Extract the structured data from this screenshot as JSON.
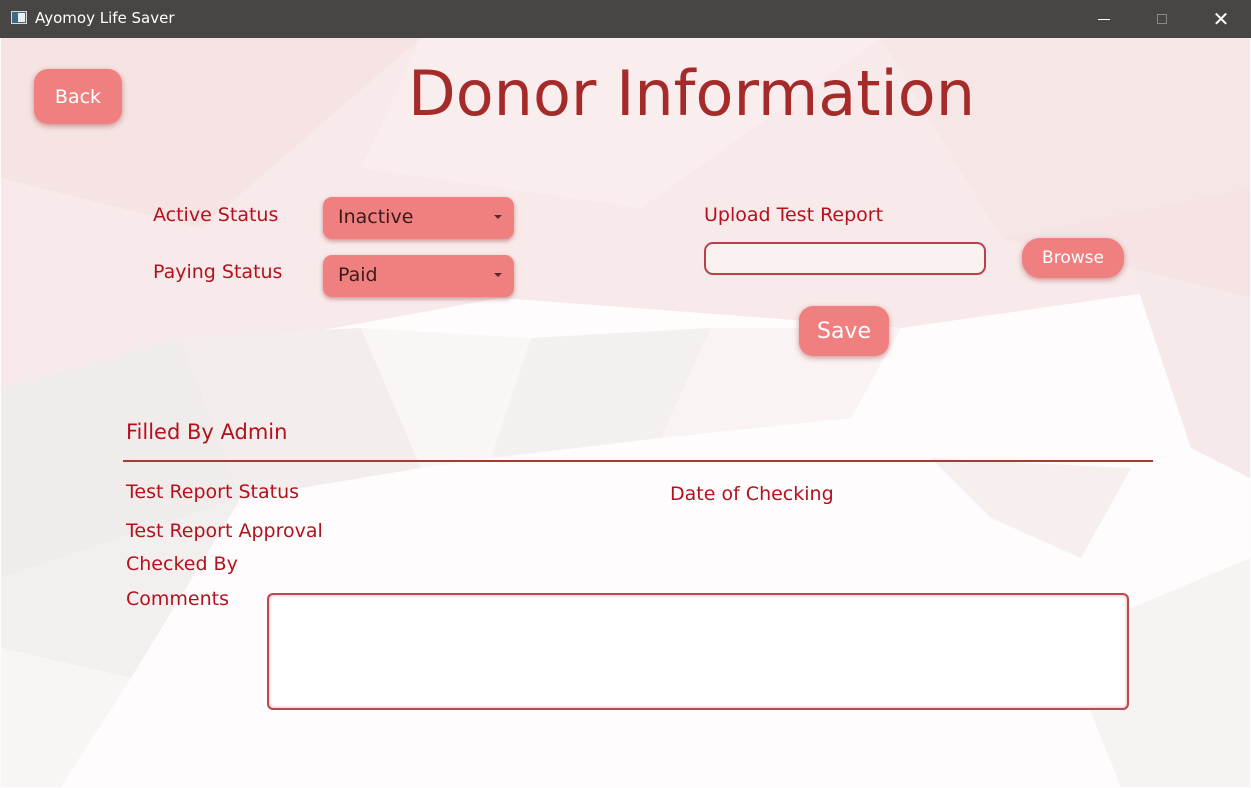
{
  "window": {
    "title": "Ayomoy Life Saver",
    "icon": "app-window-icon",
    "controls": {
      "minimize_icon": "minimize-icon",
      "maximize_icon": "maximize-icon",
      "close_icon": "close-icon",
      "close_glyph": "✕"
    }
  },
  "header": {
    "back_label": "Back",
    "title": "Donor Information"
  },
  "status": {
    "active_label": "Active Status",
    "active_value": "Inactive",
    "paying_label": "Paying Status",
    "paying_value": "Paid"
  },
  "upload": {
    "label": "Upload Test Report",
    "value": "",
    "browse_label": "Browse",
    "save_label": "Save"
  },
  "admin": {
    "section_title": "Filled By Admin",
    "test_report_status_label": "Test Report Status",
    "date_of_checking_label": "Date of Checking",
    "test_report_approval_label": "Test Report Approval",
    "checked_by_label": "Checked By",
    "comments_label": "Comments",
    "comments_value": ""
  },
  "colors": {
    "accent": "#f08080",
    "title": "#a52a2a",
    "label": "#b3121c",
    "titlebar": "#484644"
  }
}
